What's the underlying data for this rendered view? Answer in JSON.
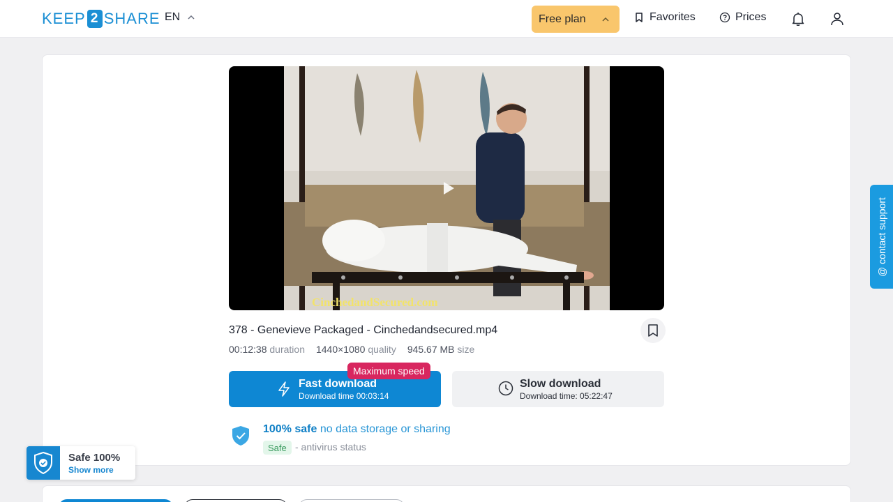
{
  "header": {
    "logo": {
      "left": "KEEP",
      "digit": "2",
      "right": "SHARE"
    },
    "language": "EN",
    "plan_label": "Free plan",
    "favorites_label": "Favorites",
    "prices_label": "Prices"
  },
  "file": {
    "title": "378 - Genevieve Packaged - Cinchedandsecured.mp4",
    "duration_value": "00:12:38",
    "duration_label": "duration",
    "quality_value": "1440×1080",
    "quality_label": "quality",
    "size_value": "945.67 MB",
    "size_label": "size",
    "watermark": "CinchedandSecured.com"
  },
  "download": {
    "speed_badge": "Maximum speed",
    "fast_label": "Fast download",
    "fast_time": "Download time 00:03:14",
    "slow_label": "Slow download",
    "slow_time": "Download time: 05:22:47"
  },
  "safety": {
    "headline_strong": "100% safe",
    "headline_rest": "no data storage or sharing",
    "tag": "Safe",
    "status": "- antivirus status"
  },
  "support_label": "@ contact support",
  "safe_widget": {
    "title": "Safe 100%",
    "link": "Show more"
  },
  "colors": {
    "brand": "#1b8fd4",
    "plan": "#f9c66c",
    "fast": "#0e87d3",
    "badge": "#d8265f"
  }
}
